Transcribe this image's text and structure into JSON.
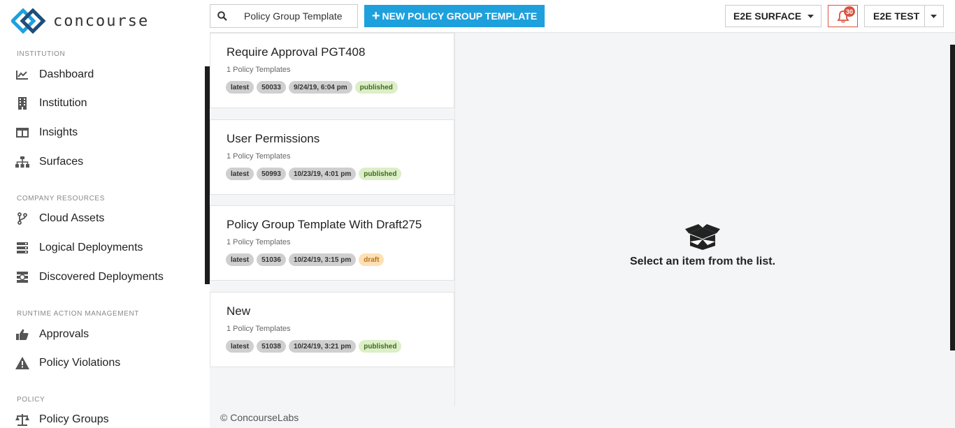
{
  "brand": {
    "name": "concourse",
    "logo_icon": "concourse-logo-icon"
  },
  "sidebar": {
    "sections": [
      {
        "title": "INSTITUTION",
        "items": [
          {
            "label": "Dashboard",
            "icon": "line-chart-icon"
          },
          {
            "label": "Institution",
            "icon": "building-icon"
          },
          {
            "label": "Insights",
            "icon": "columns-icon"
          },
          {
            "label": "Surfaces",
            "icon": "sitemap-icon"
          }
        ]
      },
      {
        "title": "COMPANY RESOURCES",
        "items": [
          {
            "label": "Cloud Assets",
            "icon": "branch-icon"
          },
          {
            "label": "Logical Deployments",
            "icon": "server-icon"
          },
          {
            "label": "Discovered Deployments",
            "icon": "search-deployment-icon"
          }
        ]
      },
      {
        "title": "RUNTIME ACTION MANAGEMENT",
        "items": [
          {
            "label": "Approvals",
            "icon": "thumbs-up-icon"
          },
          {
            "label": "Policy Violations",
            "icon": "warning-icon"
          }
        ]
      },
      {
        "title": "POLICY",
        "items": [
          {
            "label": "Policy Groups",
            "icon": "balance-scale-icon"
          }
        ]
      }
    ]
  },
  "topbar": {
    "search": {
      "value": "Policy Group Template",
      "placeholder": "Policy Group Template"
    },
    "new_button": {
      "plus": "+",
      "label": "NEW POLICY GROUP TEMPLATE"
    },
    "surface_dropdown": "E2E SURFACE",
    "notifications": {
      "count": "30",
      "icon": "bell-icon",
      "color": "#d9533f"
    },
    "user_dropdown": "E2E TEST"
  },
  "list": {
    "items": [
      {
        "title": "Require Approval PGT408",
        "subtitle": "1 Policy Templates",
        "tags": {
          "version": "latest",
          "id": "50033",
          "date": "9/24/19, 6:04 pm",
          "status": "published"
        }
      },
      {
        "title": "User Permissions",
        "subtitle": "1 Policy Templates",
        "tags": {
          "version": "latest",
          "id": "50993",
          "date": "10/23/19, 4:01 pm",
          "status": "published"
        }
      },
      {
        "title": "Policy Group Template With Draft275",
        "subtitle": "1 Policy Templates",
        "tags": {
          "version": "latest",
          "id": "51036",
          "date": "10/24/19, 3:15 pm",
          "status": "draft"
        }
      },
      {
        "title": "New",
        "subtitle": "1 Policy Templates",
        "tags": {
          "version": "latest",
          "id": "51038",
          "date": "10/24/19, 3:21 pm",
          "status": "published"
        }
      }
    ]
  },
  "detail": {
    "empty_message": "Select an item from the list.",
    "icon": "open-box-icon"
  },
  "footer": {
    "copyright": "© ConcourseLabs"
  },
  "colors": {
    "accent": "#1ea0dd",
    "published_bg": "#dcefc8",
    "draft_bg": "#fde0b5",
    "alert": "#d9533f"
  }
}
